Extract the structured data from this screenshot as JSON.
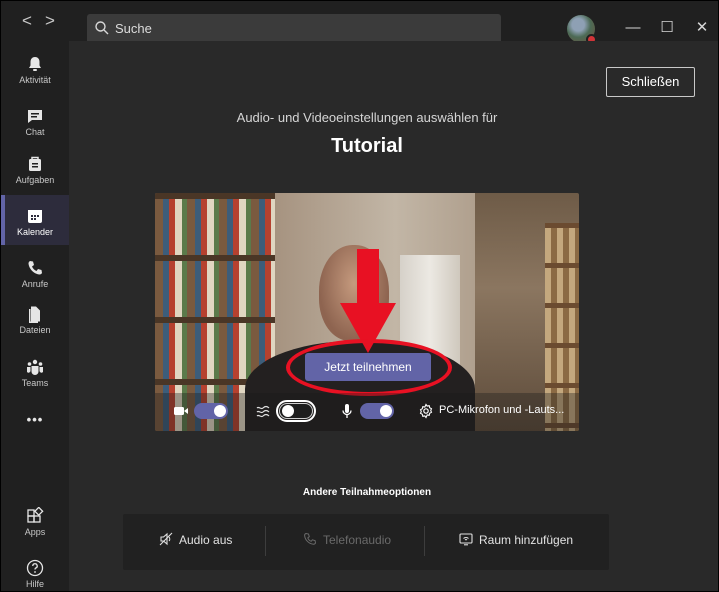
{
  "titlebar": {
    "back_label": "<",
    "forward_label": ">",
    "search_placeholder": "Suche",
    "minimize": "—",
    "maximize": "☐",
    "close": "✕"
  },
  "rail": {
    "items": [
      {
        "label": "Aktivität",
        "icon": "bell-icon"
      },
      {
        "label": "Chat",
        "icon": "chat-icon"
      },
      {
        "label": "Aufgaben",
        "icon": "briefcase-icon"
      },
      {
        "label": "Kalender",
        "icon": "calendar-icon",
        "active": true
      },
      {
        "label": "Anrufe",
        "icon": "phone-icon"
      },
      {
        "label": "Dateien",
        "icon": "file-icon"
      },
      {
        "label": "Teams",
        "icon": "teams-icon"
      }
    ],
    "more_label": "•••",
    "apps_label": "Apps",
    "help_label": "Hilfe"
  },
  "main": {
    "close_label": "Schließen",
    "subtitle": "Audio- und Videoeinstellungen auswählen für",
    "title": "Tutorial",
    "join_label": "Jetzt teilnehmen",
    "controls": {
      "camera_on": true,
      "background_blur_on": false,
      "mic_on": true,
      "device_label": "PC-Mikrofon und -Lauts..."
    },
    "other_options_title": "Andere Teilnahmeoptionen",
    "options": [
      {
        "label": "Audio aus",
        "icon": "speaker-off-icon",
        "enabled": true
      },
      {
        "label": "Telefonaudio",
        "icon": "phone-icon",
        "enabled": false
      },
      {
        "label": "Raum hinzufügen",
        "icon": "cast-icon",
        "enabled": true
      }
    ]
  },
  "colors": {
    "accent": "#6264a7",
    "annotation": "#e81123",
    "rail_bg": "#202020",
    "main_bg": "#292929"
  }
}
